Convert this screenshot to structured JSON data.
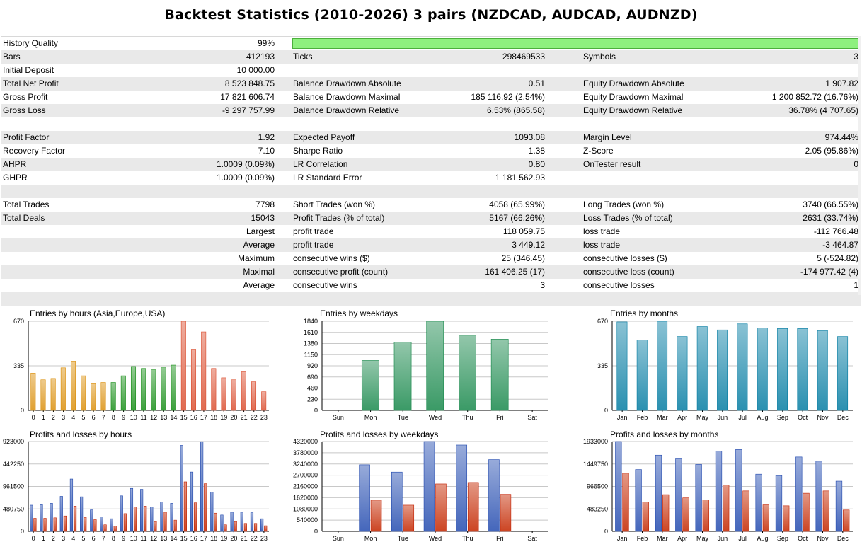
{
  "title": "Backtest Statistics (2010-2026) 3 pairs (NZDCAD, AUDCAD, AUDNZD)",
  "history_quality": {
    "label": "History Quality",
    "value": "99%",
    "fraction": 0.99
  },
  "rows": [
    {
      "l1": "Bars",
      "v1": "412193",
      "l2": "Ticks",
      "v2": "298469533",
      "l3": "Symbols",
      "v3": "3",
      "alt": true
    },
    {
      "l1": "Initial Deposit",
      "v1": "10 000.00",
      "l2": "",
      "v2": "",
      "l3": "",
      "v3": "",
      "alt": false
    },
    {
      "l1": "Total Net Profit",
      "v1": "8 523 848.75",
      "l2": "Balance Drawdown Absolute",
      "v2": "0.51",
      "l3": "Equity Drawdown Absolute",
      "v3": "1 907.82",
      "alt": true
    },
    {
      "l1": "Gross Profit",
      "v1": "17 821 606.74",
      "l2": "Balance Drawdown Maximal",
      "v2": "185 116.92 (2.54%)",
      "l3": "Equity Drawdown Maximal",
      "v3": "1 200 852.72 (16.76%)",
      "alt": false
    },
    {
      "l1": "Gross Loss",
      "v1": "-9 297 757.99",
      "l2": "Balance Drawdown Relative",
      "v2": "6.53% (865.58)",
      "l3": "Equity Drawdown Relative",
      "v3": "36.78% (4 707.65)",
      "alt": true
    },
    {
      "l1": "",
      "v1": "",
      "l2": "",
      "v2": "",
      "l3": "",
      "v3": "",
      "alt": false
    },
    {
      "l1": "Profit Factor",
      "v1": "1.92",
      "l2": "Expected Payoff",
      "v2": "1093.08",
      "l3": "Margin Level",
      "v3": "974.44%",
      "alt": true
    },
    {
      "l1": "Recovery Factor",
      "v1": "7.10",
      "l2": "Sharpe Ratio",
      "v2": "1.38",
      "l3": "Z-Score",
      "v3": "2.05 (95.86%)",
      "alt": false
    },
    {
      "l1": "AHPR",
      "v1": "1.0009 (0.09%)",
      "l2": "LR Correlation",
      "v2": "0.80",
      "l3": "OnTester result",
      "v3": "0",
      "alt": true
    },
    {
      "l1": "GHPR",
      "v1": "1.0009 (0.09%)",
      "l2": "LR Standard Error",
      "v2": "1 181 562.93",
      "l3": "",
      "v3": "",
      "alt": false
    },
    {
      "l1": "",
      "v1": "",
      "l2": "",
      "v2": "",
      "l3": "",
      "v3": "",
      "alt": true
    },
    {
      "l1": "Total Trades",
      "v1": "7798",
      "l2": "Short Trades (won %)",
      "v2": "4058 (65.99%)",
      "l3": "Long Trades (won %)",
      "v3": "3740 (66.55%)",
      "alt": false
    },
    {
      "l1": "Total Deals",
      "v1": "15043",
      "l2": "Profit Trades (% of total)",
      "v2": "5167 (66.26%)",
      "l3": "Loss Trades (% of total)",
      "v3": "2631 (33.74%)",
      "alt": true
    },
    {
      "l1": "",
      "v1": "Largest",
      "l2": "profit trade",
      "v2": "118 059.75",
      "l3": "loss trade",
      "v3": "-112 766.48",
      "alt": false
    },
    {
      "l1": "",
      "v1": "Average",
      "l2": "profit trade",
      "v2": "3 449.12",
      "l3": "loss trade",
      "v3": "-3 464.87",
      "alt": true
    },
    {
      "l1": "",
      "v1": "Maximum",
      "l2": "consecutive wins ($)",
      "v2": "25 (346.45)",
      "l3": "consecutive losses ($)",
      "v3": "5 (-524.82)",
      "alt": false
    },
    {
      "l1": "",
      "v1": "Maximal",
      "l2": "consecutive profit (count)",
      "v2": "161 406.25 (17)",
      "l3": "consecutive loss (count)",
      "v3": "-174 977.42 (4)",
      "alt": true
    },
    {
      "l1": "",
      "v1": "Average",
      "l2": "consecutive wins",
      "v2": "3",
      "l3": "consecutive losses",
      "v3": "1",
      "alt": false
    },
    {
      "l1": "",
      "v1": "",
      "l2": "",
      "v2": "",
      "l3": "",
      "v3": "",
      "alt": true
    }
  ],
  "colors": {
    "bar_asia": "#e0a030",
    "bar_europe": "#3ca03c",
    "bar_usa": "#e06a50",
    "weekday": "#3a9a66",
    "months": "#2a90b0",
    "profit": "#4466bb",
    "loss": "#cc4422",
    "quality_bar": "#8ef07e"
  },
  "chart_data": [
    {
      "id": "entries_hours",
      "type": "bar",
      "title": "Entries by hours (Asia,Europe,USA)",
      "ylim": [
        0,
        670
      ],
      "yticks": [
        "0",
        "335",
        "670"
      ],
      "categories": [
        "0",
        "1",
        "2",
        "3",
        "4",
        "5",
        "6",
        "7",
        "8",
        "9",
        "10",
        "11",
        "12",
        "13",
        "14",
        "15",
        "16",
        "17",
        "18",
        "19",
        "20",
        "21",
        "22",
        "23"
      ],
      "series": [
        {
          "values": [
            280,
            230,
            240,
            320,
            370,
            260,
            200,
            210,
            210,
            260,
            330,
            315,
            305,
            325,
            340,
            670,
            460,
            590,
            315,
            245,
            230,
            290,
            215,
            140
          ]
        }
      ]
    },
    {
      "id": "entries_weekdays",
      "type": "bar",
      "title": "Entries by weekdays",
      "ylim": [
        0,
        1840
      ],
      "yticks": [
        "0",
        "230",
        "460",
        "690",
        "920",
        "1150",
        "1380",
        "1610",
        "1840"
      ],
      "categories": [
        "Sun",
        "Mon",
        "Tue",
        "Wed",
        "Thu",
        "Fri",
        "Sat"
      ],
      "series": [
        {
          "values": [
            0,
            1030,
            1410,
            1850,
            1550,
            1470,
            0
          ]
        }
      ]
    },
    {
      "id": "entries_months",
      "type": "bar",
      "title": "Entries by months",
      "ylim": [
        0,
        670
      ],
      "yticks": [
        "0",
        "335",
        "670"
      ],
      "categories": [
        "Jan",
        "Feb",
        "Mar",
        "Apr",
        "May",
        "Jun",
        "Jul",
        "Aug",
        "Sep",
        "Oct",
        "Nov",
        "Dec"
      ],
      "series": [
        {
          "values": [
            665,
            530,
            675,
            555,
            630,
            605,
            650,
            620,
            615,
            615,
            600,
            555
          ]
        }
      ]
    },
    {
      "id": "pl_hours",
      "type": "bar",
      "title": "Profits and losses by hours",
      "ylim": [
        0,
        1923000
      ],
      "yticks": [
        "0",
        "480750",
        "961500",
        "442250",
        "923000"
      ],
      "categories": [
        "0",
        "1",
        "2",
        "3",
        "4",
        "5",
        "6",
        "7",
        "8",
        "9",
        "10",
        "11",
        "12",
        "13",
        "14",
        "15",
        "16",
        "17",
        "18",
        "19",
        "20",
        "21",
        "22",
        "23"
      ],
      "series": [
        {
          "values": [
            560000,
            570000,
            600000,
            750000,
            1120000,
            740000,
            460000,
            310000,
            270000,
            760000,
            920000,
            900000,
            520000,
            630000,
            600000,
            1840000,
            1270000,
            1920000,
            840000,
            350000,
            410000,
            410000,
            400000,
            270000
          ]
        },
        {
          "values": [
            280000,
            280000,
            290000,
            330000,
            540000,
            300000,
            250000,
            140000,
            110000,
            380000,
            520000,
            540000,
            210000,
            410000,
            240000,
            1060000,
            610000,
            1020000,
            390000,
            140000,
            210000,
            170000,
            170000,
            120000
          ]
        }
      ]
    },
    {
      "id": "pl_weekdays",
      "type": "bar",
      "title": "Profits and losses by weekdays",
      "ylim": [
        0,
        4320000
      ],
      "yticks": [
        "0",
        "540000",
        "1080000",
        "1620000",
        "2160000",
        "2700000",
        "3240000",
        "3780000",
        "4320000"
      ],
      "categories": [
        "Sun",
        "Mon",
        "Tue",
        "Wed",
        "Thu",
        "Fri",
        "Sat"
      ],
      "series": [
        {
          "values": [
            0,
            3200000,
            2850000,
            4350000,
            4150000,
            3450000,
            0
          ]
        },
        {
          "values": [
            0,
            1500000,
            1260000,
            2280000,
            2350000,
            1780000,
            0
          ]
        }
      ]
    },
    {
      "id": "pl_months",
      "type": "bar",
      "title": "Profits and losses by months",
      "ylim": [
        0,
        1933000
      ],
      "yticks": [
        "0",
        "483250",
        "966500",
        "1449750",
        "1933000"
      ],
      "categories": [
        "Jan",
        "Feb",
        "Mar",
        "Apr",
        "May",
        "Jun",
        "Jul",
        "Aug",
        "Sep",
        "Oct",
        "Nov",
        "Dec"
      ],
      "series": [
        {
          "values": [
            1940000,
            1330000,
            1640000,
            1560000,
            1440000,
            1730000,
            1760000,
            1230000,
            1200000,
            1600000,
            1510000,
            1080000
          ]
        },
        {
          "values": [
            1250000,
            630000,
            790000,
            720000,
            680000,
            1000000,
            870000,
            570000,
            550000,
            820000,
            870000,
            460000
          ]
        }
      ]
    }
  ]
}
